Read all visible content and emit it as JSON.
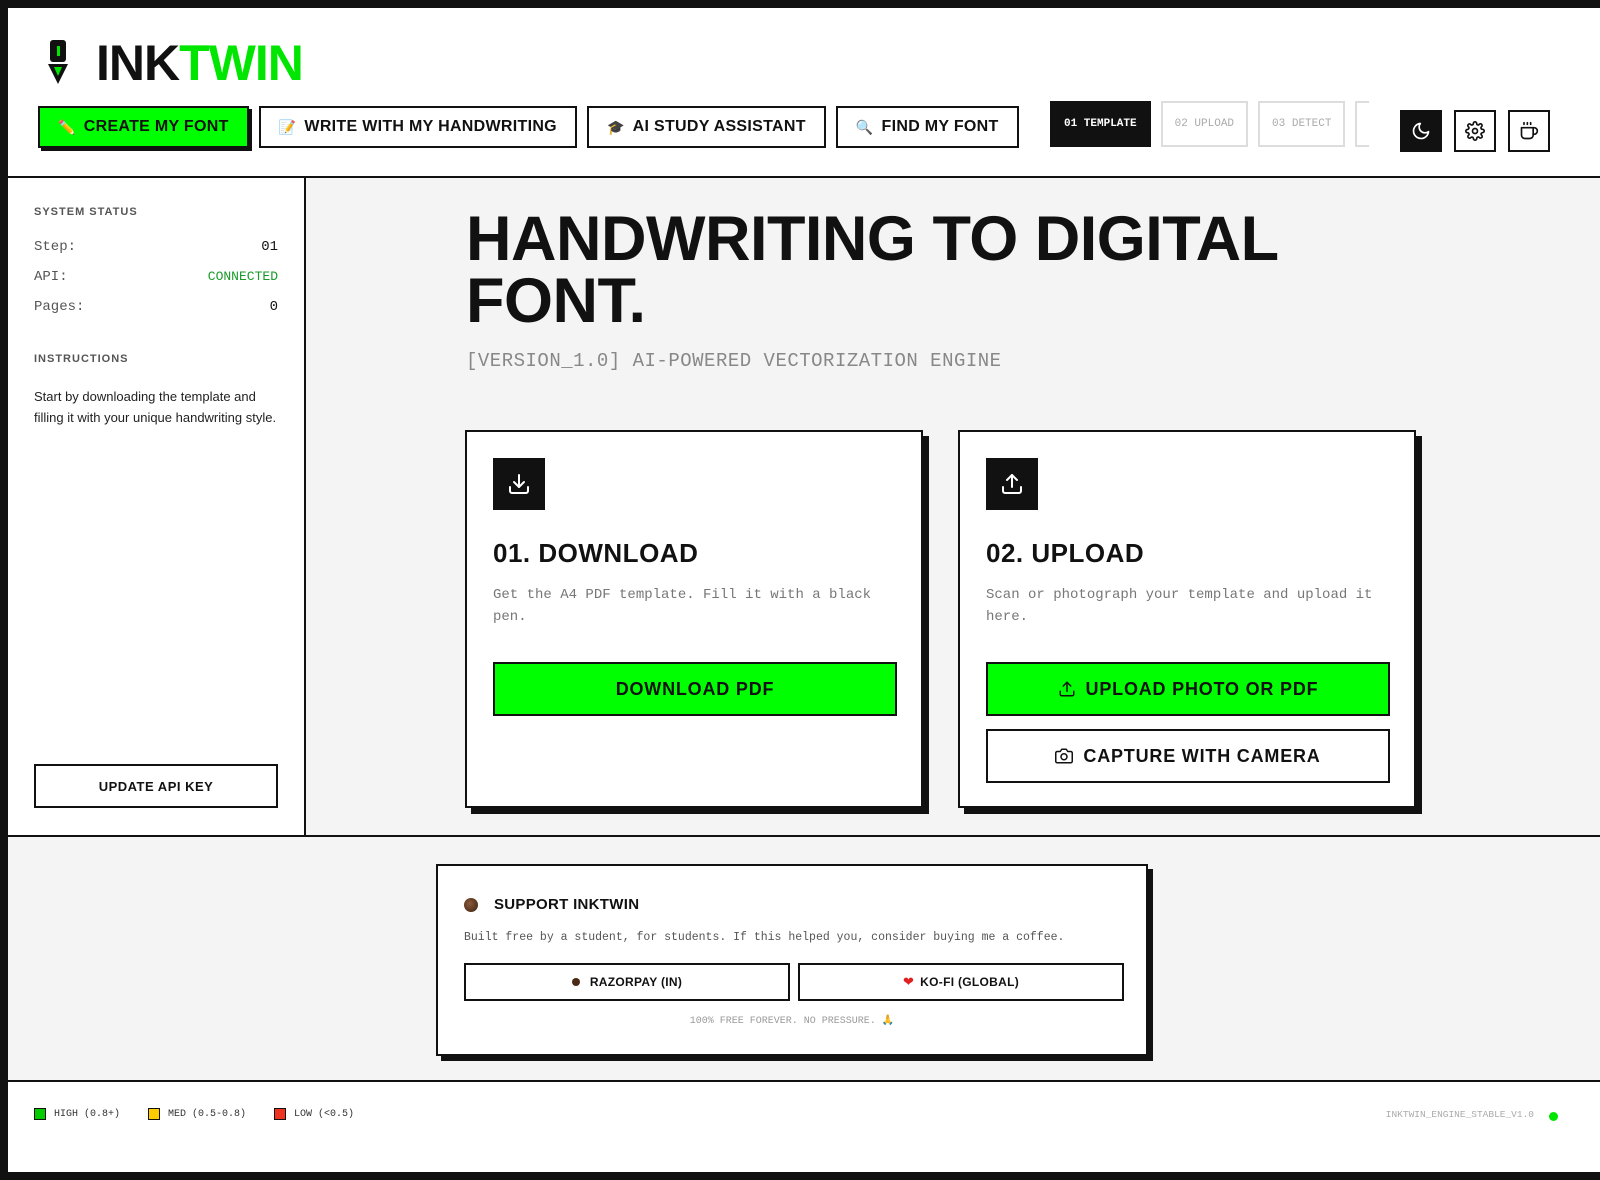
{
  "brand": {
    "ink": "INK",
    "twin": "TWIN",
    "accent_color": "#00ff00"
  },
  "nav": {
    "create": {
      "label": "CREATE MY FONT",
      "icon": "pencil-icon"
    },
    "write": {
      "label": "WRITE WITH MY HANDWRITING",
      "icon": "memo-icon"
    },
    "study": {
      "label": "AI STUDY ASSISTANT",
      "icon": "graduation-cap-icon"
    },
    "find": {
      "label": "FIND MY FONT",
      "icon": "magnifier-icon"
    }
  },
  "steps": [
    "01 TEMPLATE",
    "02 UPLOAD",
    "03 DETECT"
  ],
  "header_icons": [
    "moon-icon",
    "gear-icon",
    "coffee-cup-icon"
  ],
  "sidebar": {
    "status_label": "SYSTEM STATUS",
    "rows": [
      {
        "key": "Step:",
        "value": "01"
      },
      {
        "key": "API:",
        "value": "CONNECTED"
      },
      {
        "key": "Pages:",
        "value": "0"
      }
    ],
    "instructions_label": "INSTRUCTIONS",
    "instructions": "Start by downloading the template and filling it with your unique handwriting style.",
    "api_button": "UPDATE API KEY"
  },
  "main": {
    "title_line1": "HANDWRITING TO DIGITAL",
    "title_line2": "FONT.",
    "subtitle": "[VERSION_1.0] AI-POWERED VECTORIZATION ENGINE",
    "download": {
      "title": "01. DOWNLOAD",
      "desc": "Get the A4 PDF template. Fill it with a black pen.",
      "button": "DOWNLOAD PDF"
    },
    "upload": {
      "title": "02. UPLOAD",
      "desc": "Scan or photograph your template and upload it here.",
      "button": "UPLOAD PHOTO OR PDF",
      "camera_button": "CAPTURE WITH CAMERA"
    }
  },
  "support": {
    "title": "SUPPORT INKTWIN",
    "desc": "Built free by a student, for students. If this helped you, consider buying me a coffee.",
    "razorpay": "RAZORPAY (IN)",
    "kofi": "KO-FI (GLOBAL)",
    "footnote": "100% FREE FOREVER. NO PRESSURE. 🙏"
  },
  "footer": {
    "legend": [
      {
        "label": "HIGH (0.8+)",
        "color": "#00cc00"
      },
      {
        "label": "MED (0.5-0.8)",
        "color": "#ffcc00"
      },
      {
        "label": "LOW (<0.5)",
        "color": "#ee3322"
      }
    ],
    "engine": "INKTWIN_ENGINE_STABLE_V1.0",
    "live_color": "#00e600"
  }
}
